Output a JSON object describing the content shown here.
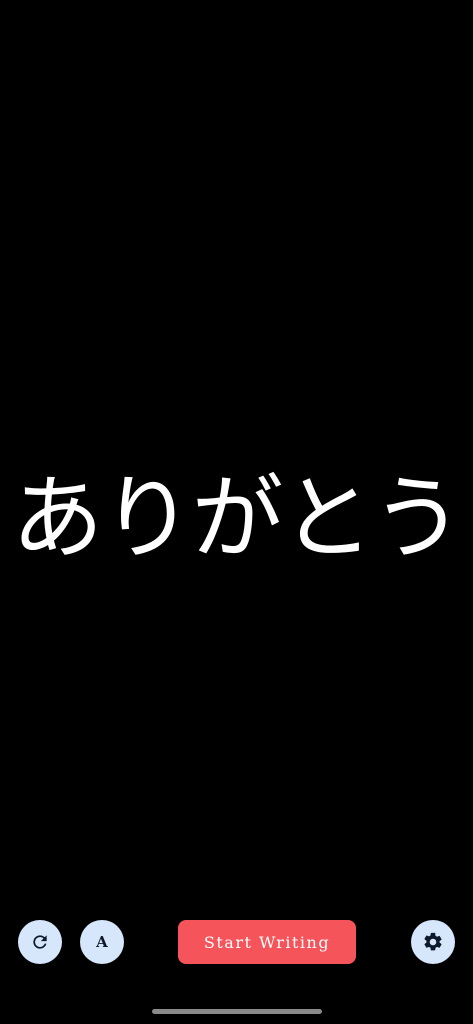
{
  "display": {
    "text": "ありがとう"
  },
  "toolbar": {
    "refresh_icon": "refresh-icon",
    "font_label": "A",
    "font_icon": "font-icon",
    "start_label": "Start Writing",
    "settings_icon": "gear-icon"
  },
  "colors": {
    "background": "#000000",
    "text": "#ffffff",
    "circle_button_bg": "#d6e6fb",
    "icon_color": "#0e1a2b",
    "primary_button_bg": "#f5555a",
    "primary_button_text": "#ffffff",
    "home_indicator": "#8a8a8a"
  }
}
